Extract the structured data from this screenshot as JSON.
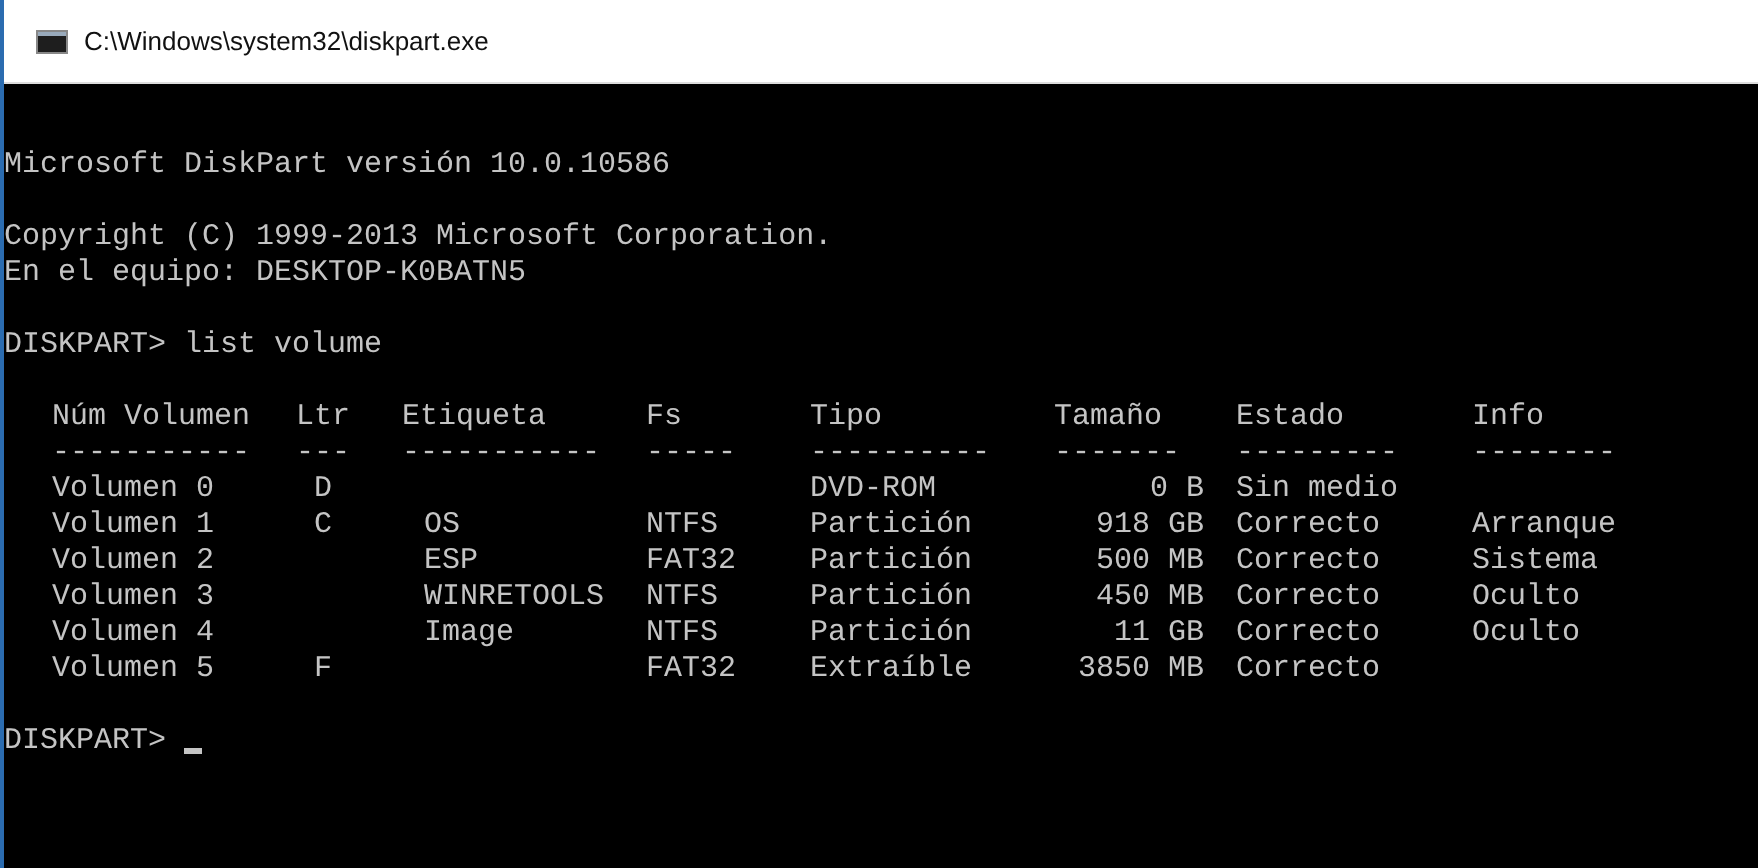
{
  "window": {
    "title": "C:\\Windows\\system32\\diskpart.exe"
  },
  "console": {
    "intro": [
      [
        "Microsoft DiskPart versión 10.0.10586"
      ],
      [
        "Copyright (C) 1999-2013 Microsoft Corporation.",
        "En el equipo: DESKTOP-K0BATN5"
      ],
      [
        "DISKPART> list volume"
      ]
    ],
    "table": {
      "columns": [
        {
          "label": "Núm Volumen",
          "rule": "-----------"
        },
        {
          "label": "Ltr",
          "rule": "---"
        },
        {
          "label": "Etiqueta",
          "rule": "-----------"
        },
        {
          "label": "Fs",
          "rule": "-----"
        },
        {
          "label": "Tipo",
          "rule": "----------"
        },
        {
          "label": "Tamaño",
          "rule": "-------"
        },
        {
          "label": "Estado",
          "rule": "---------"
        },
        {
          "label": "Info",
          "rule": "--------"
        }
      ],
      "rows": [
        [
          "Volumen 0",
          "D",
          "",
          "",
          "DVD-ROM",
          "0 B",
          "Sin medio",
          ""
        ],
        [
          "Volumen 1",
          "C",
          "OS",
          "NTFS",
          "Partición",
          "918 GB",
          "Correcto",
          "Arranque"
        ],
        [
          "Volumen 2",
          "",
          "ESP",
          "FAT32",
          "Partición",
          "500 MB",
          "Correcto",
          "Sistema"
        ],
        [
          "Volumen 3",
          "",
          "WINRETOOLS",
          "NTFS",
          "Partición",
          "450 MB",
          "Correcto",
          "Oculto"
        ],
        [
          "Volumen 4",
          "",
          "Image",
          "NTFS",
          "Partición",
          "11 GB",
          "Correcto",
          "Oculto"
        ],
        [
          "Volumen 5",
          "F",
          "",
          "FAT32",
          "Extraíble",
          "3850 MB",
          "Correcto",
          ""
        ]
      ]
    },
    "prompt": "DISKPART>"
  }
}
